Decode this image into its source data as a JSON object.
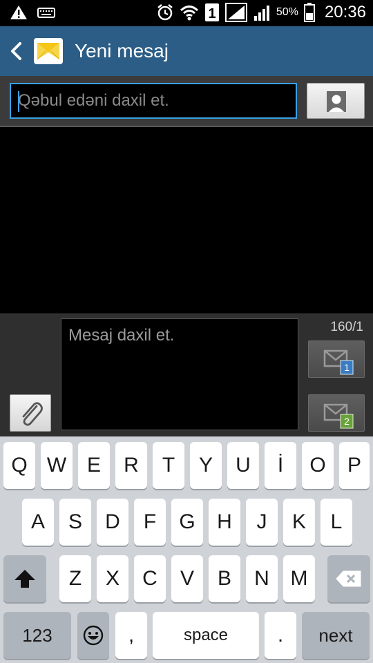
{
  "status_bar": {
    "battery_percent": "50%",
    "time": "20:36",
    "sim_label": "1",
    "icons": [
      "warning-icon",
      "keyboard-icon",
      "alarm-icon",
      "wifi-icon",
      "sim1-icon",
      "signal-icon",
      "signal2-icon",
      "battery-icon"
    ]
  },
  "app_bar": {
    "title": "Yeni mesaj",
    "icons": [
      "back-arrow-icon",
      "message-envelope-icon"
    ]
  },
  "recipient": {
    "placeholder": "Qəbul edəni daxil et."
  },
  "compose": {
    "placeholder": "Mesaj daxil et.",
    "counter": "160/1",
    "send_buttons": [
      {
        "sim": "1",
        "color": "#3a7cc2"
      },
      {
        "sim": "2",
        "color": "#6aa23a"
      }
    ]
  },
  "keyboard": {
    "row1": [
      "Q",
      "W",
      "E",
      "R",
      "T",
      "Y",
      "U",
      "İ",
      "O",
      "P"
    ],
    "row2": [
      "A",
      "S",
      "D",
      "F",
      "G",
      "H",
      "J",
      "K",
      "L"
    ],
    "row3": [
      "Z",
      "X",
      "C",
      "V",
      "B",
      "N",
      "M"
    ],
    "mode_key": "123",
    "comma": ",",
    "space": "space",
    "period": ".",
    "action": "next",
    "icons": [
      "shift-icon",
      "backspace-icon",
      "emoji-icon"
    ]
  },
  "colors": {
    "app_bar": "#2c5d86",
    "accent": "#3aa0e6",
    "keyboard_bg": "#cfd3d8"
  }
}
